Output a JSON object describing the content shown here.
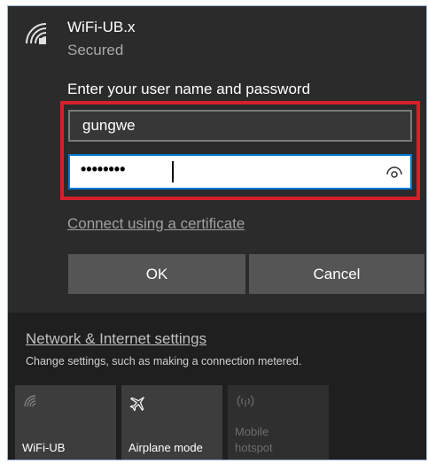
{
  "network": {
    "name": "WiFi-UB.x",
    "status": "Secured",
    "icon": "wifi-secured-icon"
  },
  "auth": {
    "prompt": "Enter your user name and password",
    "username_value": "gungwe",
    "password_masked": "••••••••",
    "reveal_icon": "eye-icon"
  },
  "cert_link": "Connect using a certificate",
  "buttons": {
    "ok": "OK",
    "cancel": "Cancel"
  },
  "settings": {
    "link": "Network & Internet settings",
    "description": "Change settings, such as making a connection metered."
  },
  "tiles": [
    {
      "label": "WiFi-UB",
      "icon": "wifi-icon",
      "enabled": true
    },
    {
      "label": "Airplane mode",
      "icon": "airplane-icon",
      "enabled": true
    },
    {
      "label": "Mobile hotspot",
      "line1": "Mobile",
      "line2": "hotspot",
      "icon": "mobile-hotspot-icon",
      "enabled": false
    }
  ],
  "colors": {
    "highlight": "#d4202a",
    "focus_border": "#0078d7",
    "panel_bg": "#2b2b2b",
    "bottom_bg": "#1f1f1f"
  }
}
